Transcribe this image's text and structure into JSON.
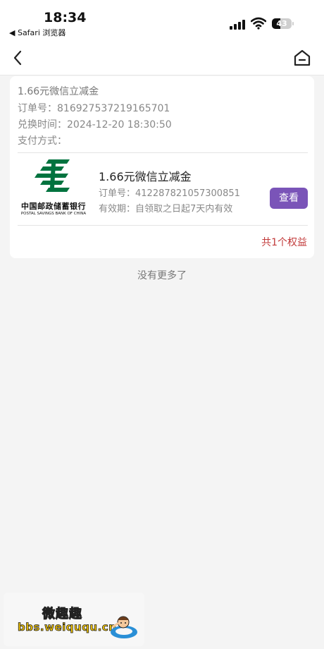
{
  "status_bar": {
    "time": "18:34",
    "back_app": "◀ Safari 浏览器",
    "battery": "43"
  },
  "nav": {
    "back_icon": "chevron-left-icon",
    "home_icon": "home-icon"
  },
  "order": {
    "title": "1.66元微信立减金",
    "order_no_label": "订单号：",
    "order_no": "816927537219165701",
    "exchange_time_label": "兑换时间：",
    "exchange_time": "2024-12-20 18:30:50",
    "payment_label": "支付方式：",
    "payment": ""
  },
  "item": {
    "logo_cn": "中国邮政储蓄银行",
    "logo_en": "POSTAL SAVINGS BANK OF CHINA",
    "name": "1.66元微信立减金",
    "order_no_label": "订单号：",
    "order_no": "412287821057300851",
    "validity_label": "有效期：",
    "validity": "自领取之日起7天内有效",
    "view_button": "查看",
    "brand_color": "#00733f",
    "button_color": "#7a54b8"
  },
  "summary": {
    "total": "共1个权益"
  },
  "list_end": "没有更多了",
  "watermark": {
    "title": "微趣趣",
    "url": "bbs.weiququ.cn"
  }
}
